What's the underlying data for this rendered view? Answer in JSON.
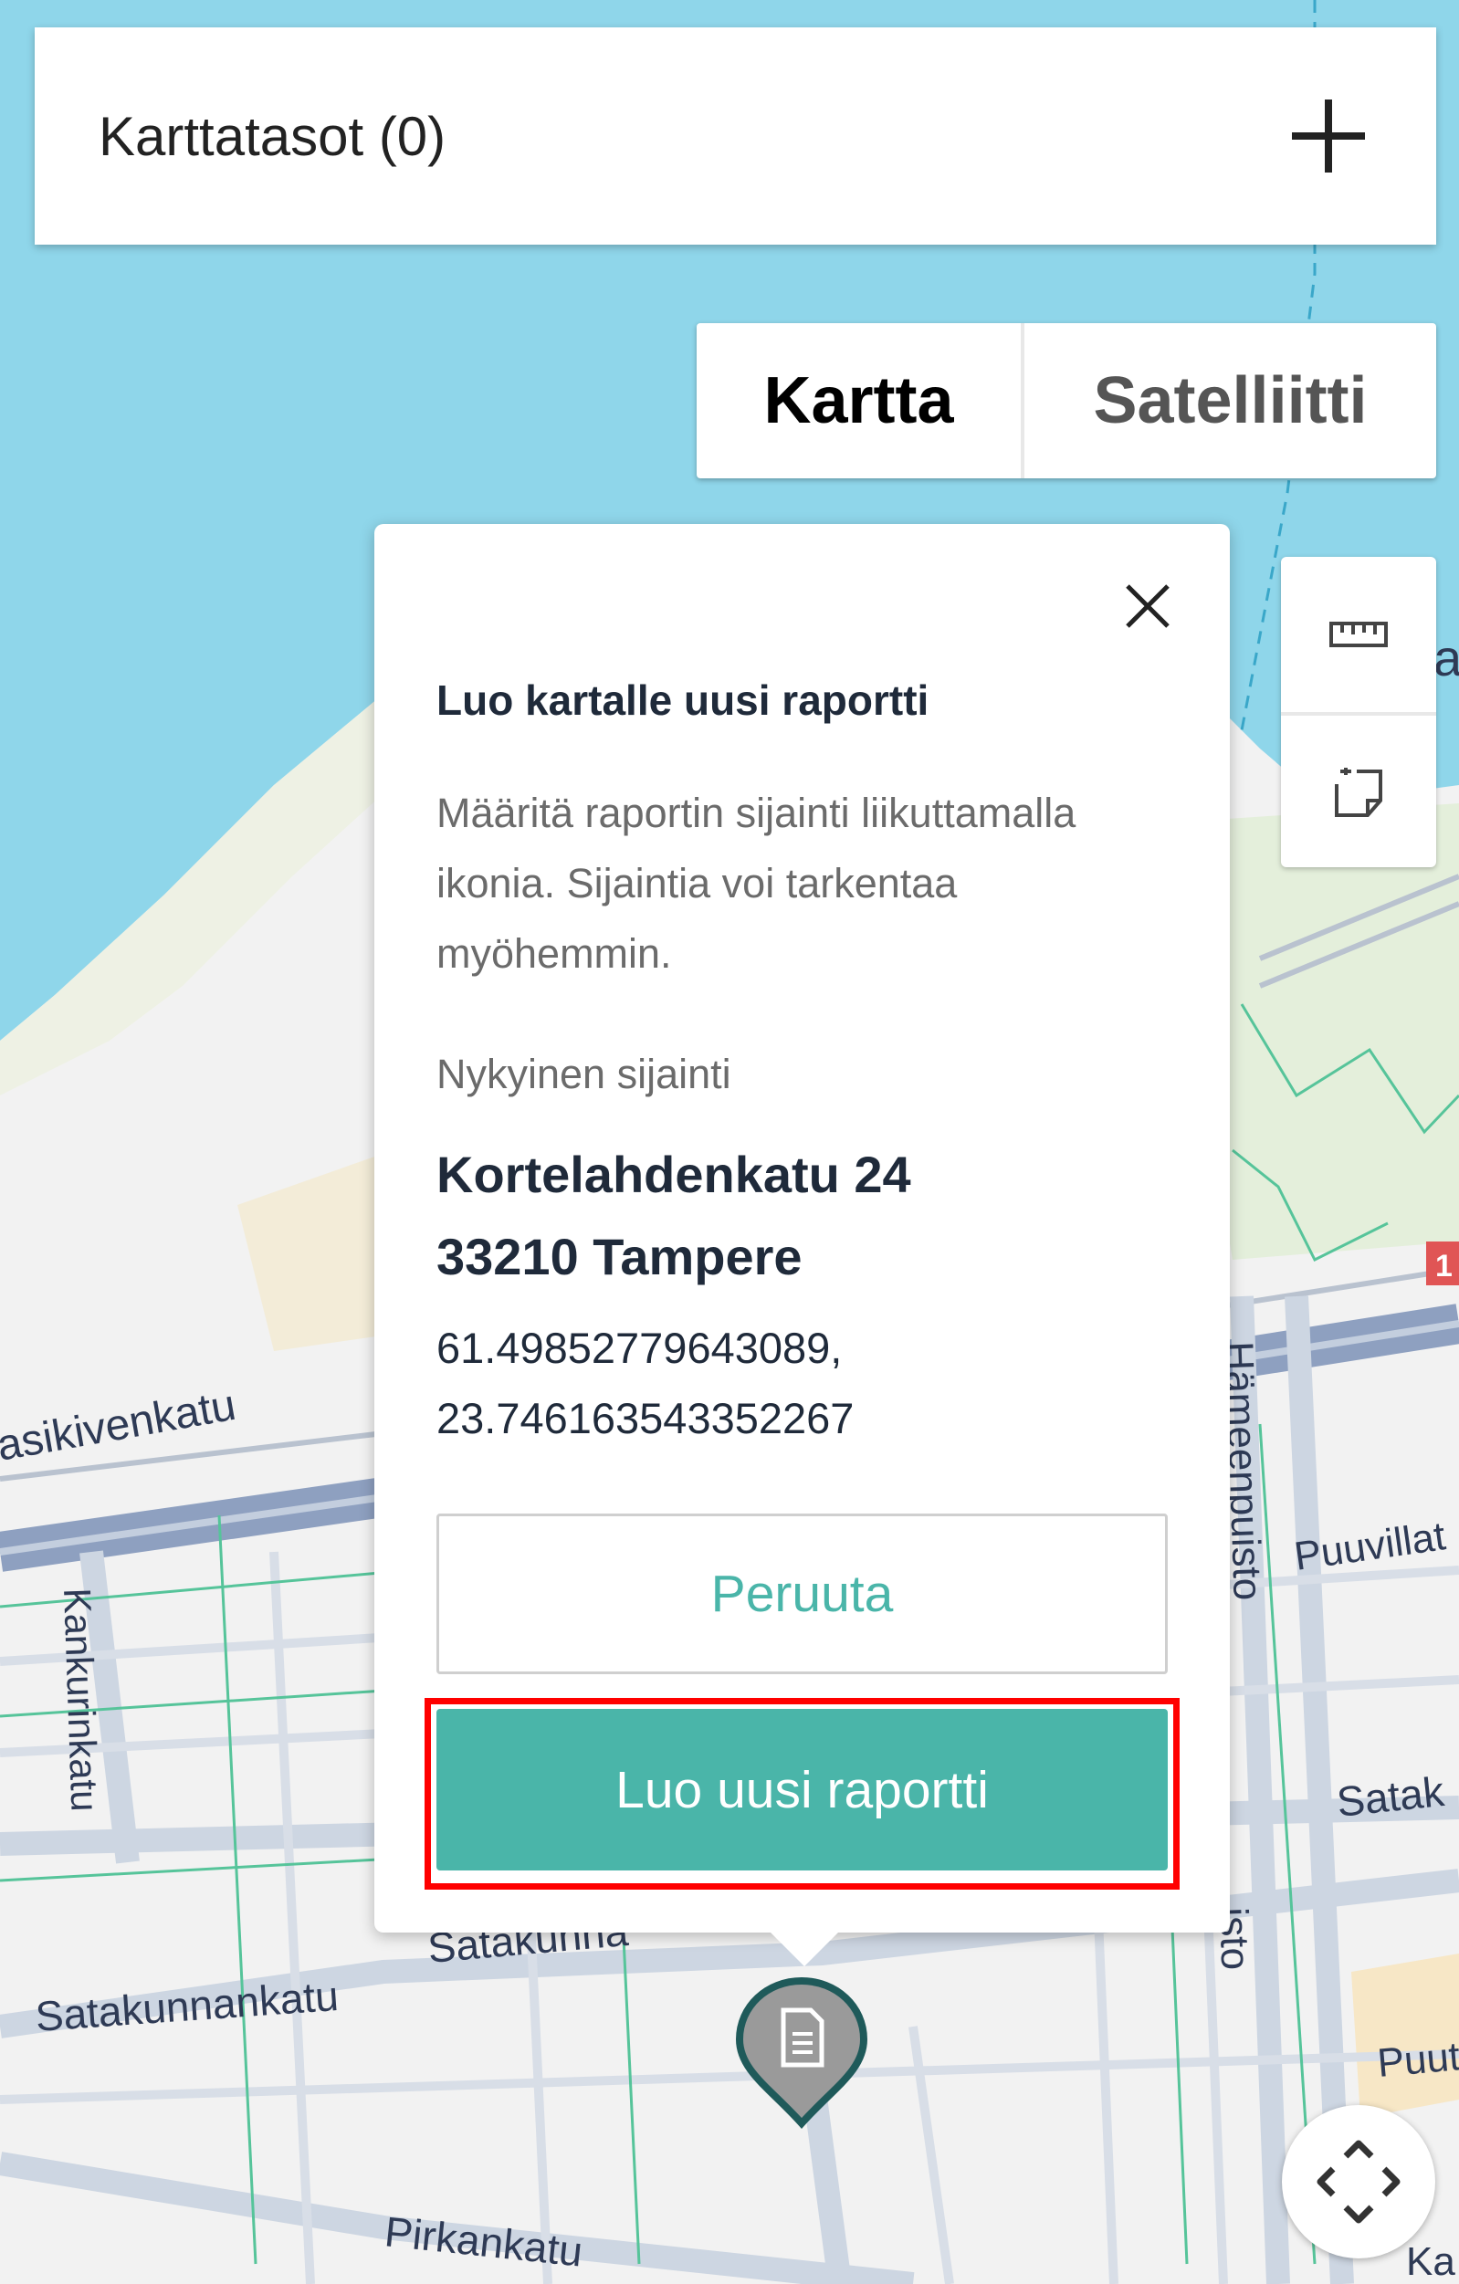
{
  "layers": {
    "title": "Karttatasot (0)",
    "add_icon": "plus-icon"
  },
  "map_type": {
    "map_label": "Kartta",
    "satellite_label": "Satelliitti",
    "selected": "Kartta"
  },
  "tools": {
    "ruler_icon": "ruler-icon",
    "add_report_icon": "add-note-icon"
  },
  "popup": {
    "title": "Luo kartalle uusi raportti",
    "description_lines": [
      "Määritä raportin sijainti liikuttamalla",
      "ikonia. Sijaintia voi tarkentaa",
      "myöhemmin."
    ],
    "location_label": "Nykyinen sijainti",
    "address_line1": "Kortelahdenkatu 24",
    "address_line2": "33210 Tampere",
    "lat": "61.49852779643089,",
    "lng": "23.746163543352267",
    "cancel_label": "Peruuta",
    "create_label": "Luo uusi raportti"
  },
  "map": {
    "streets": [
      "asikivenkatu",
      "Kankurinkatu",
      "Satakunnankatu",
      "Satakunna",
      "Pirkankatu",
      "Hämeenpuisto",
      "Puuvillat",
      "Satak",
      "Puut",
      "Ka",
      "isto",
      "1",
      "a"
    ],
    "colors": {
      "water": "#8fd6ea",
      "land": "#f2f2f2",
      "park": "#e6f1dc",
      "sand": "#f4efe1",
      "road": "#cdd6e2",
      "rail": "#8ea0c0",
      "path": "#56c49a",
      "accent": "#4ab5a9",
      "highlight": "#ff0000"
    }
  },
  "marker_icon": "document-icon",
  "recenter_icon": "recenter-arrows-icon"
}
